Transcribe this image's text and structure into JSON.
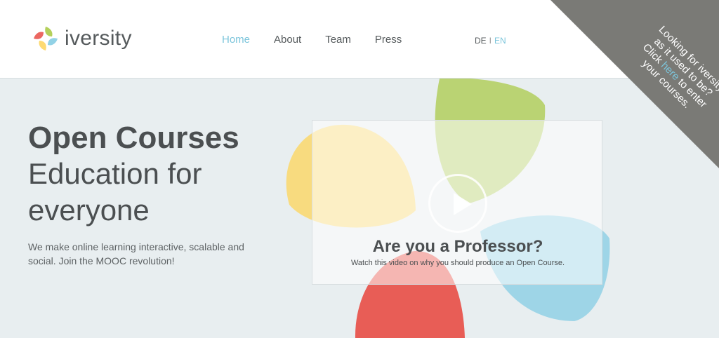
{
  "brand": {
    "name": "iversity"
  },
  "nav": {
    "items": [
      {
        "label": "Home"
      },
      {
        "label": "About"
      },
      {
        "label": "Team"
      },
      {
        "label": "Press"
      }
    ]
  },
  "lang": {
    "de": "DE",
    "sep": "I",
    "en": "EN"
  },
  "corner_banner": {
    "text_before": "Looking for iversity as it used to be? Click ",
    "link": "here",
    "text_after": " to enter your courses."
  },
  "hero": {
    "title": "Open Courses",
    "subtitle_line1": "Education for",
    "subtitle_line2": "everyone",
    "description": "We make online learning interactive, scalable and social. Join the MOOC revolution!"
  },
  "video": {
    "title": "Are you a Professor?",
    "subtitle": "Watch this video on why you should produce an Open Course."
  },
  "colors": {
    "accent": "#7cc5db",
    "text": "#4b4f51",
    "background": "#e8eef0",
    "banner": "#7a7a76",
    "petal_yellow": "#fdd45a",
    "petal_green": "#a7c83d",
    "petal_blue": "#7fcae2",
    "petal_red": "#e84c45"
  },
  "icons": {
    "logo": "iversity-logo-icon",
    "play": "play-icon"
  }
}
